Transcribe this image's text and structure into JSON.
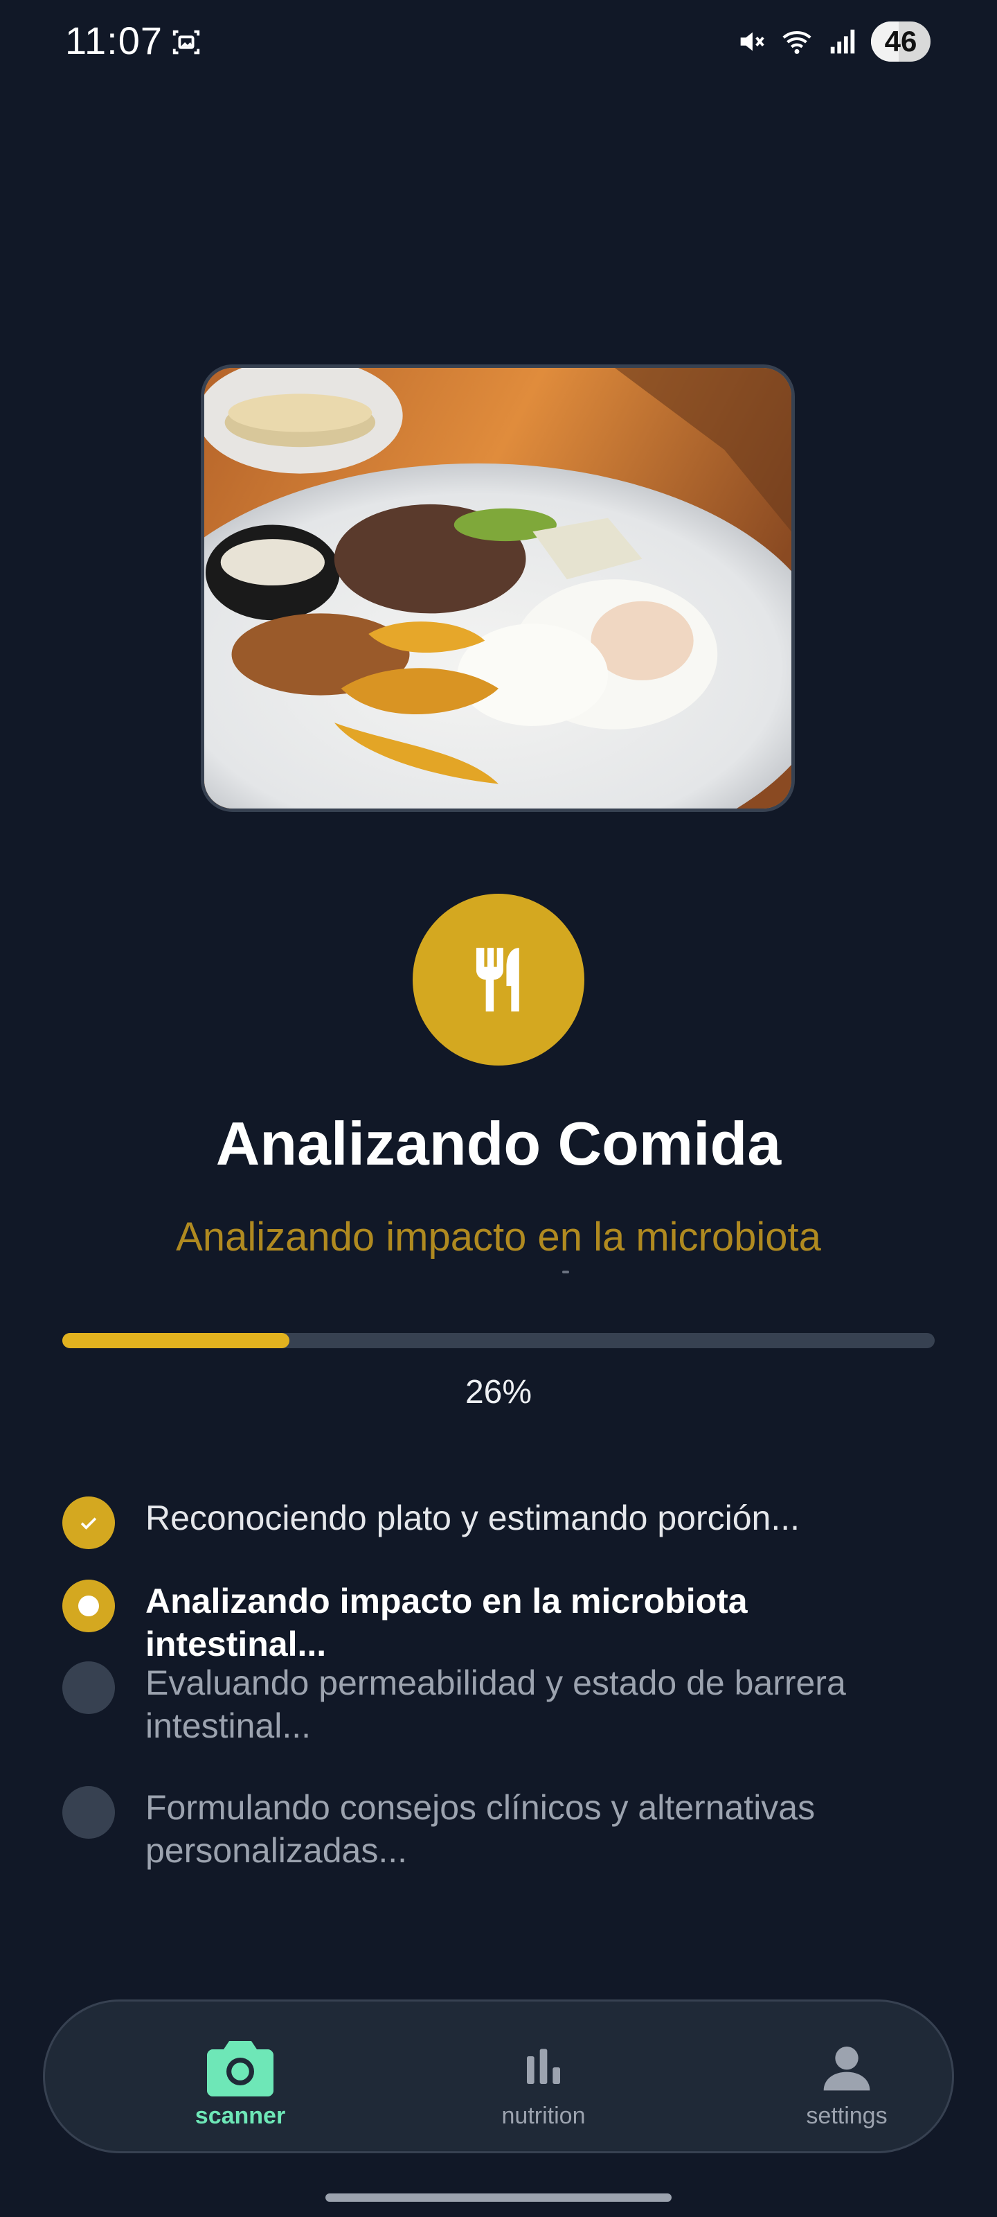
{
  "status_bar": {
    "time": "11:07",
    "battery_level": "46",
    "icons": [
      "screen-record-icon",
      "mute-icon",
      "wifi-icon",
      "signal-icon",
      "battery-icon"
    ]
  },
  "analysis": {
    "title": "Analizando Comida",
    "subtitle": "Analizando impacto en la microbiota",
    "progress_percent": 26,
    "progress_label": "26%"
  },
  "steps": [
    {
      "label": "Reconociendo plato y estimando porción...",
      "state": "done"
    },
    {
      "label": "Analizando impacto en la microbiota intestinal...",
      "state": "active"
    },
    {
      "label": "Evaluando permeabilidad y estado de barrera intestinal...",
      "state": "pending"
    },
    {
      "label": "Formulando consejos clínicos y alternativas personalizadas...",
      "state": "pending"
    }
  ],
  "nav": {
    "items": [
      {
        "label": "scanner",
        "icon": "camera-icon",
        "active": true
      },
      {
        "label": "nutrition",
        "icon": "bar-chart-icon",
        "active": false
      },
      {
        "label": "settings",
        "icon": "person-icon",
        "active": false
      }
    ]
  },
  "colors": {
    "background": "#111827",
    "accent": "#d4a820",
    "nav_active": "#6ee7b7",
    "nav_inactive": "#9ca3af"
  }
}
